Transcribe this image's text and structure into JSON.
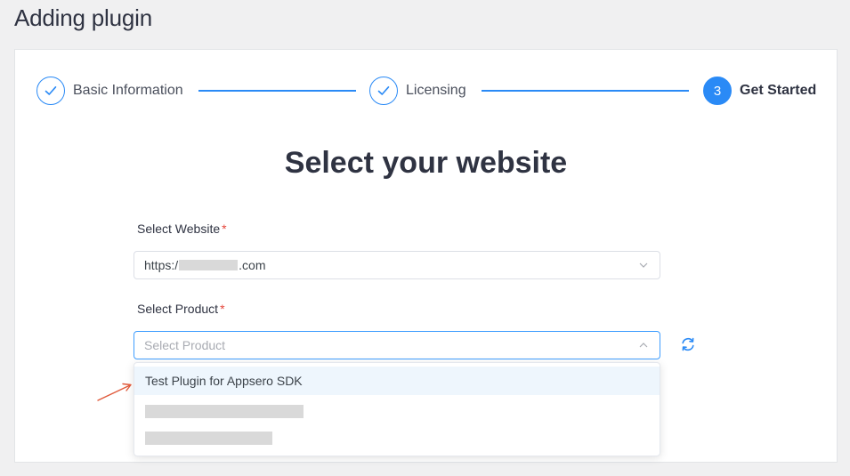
{
  "page": {
    "title": "Adding plugin"
  },
  "steps": [
    {
      "label": "Basic Information",
      "state": "done"
    },
    {
      "label": "Licensing",
      "state": "done"
    },
    {
      "number": "3",
      "label": "Get Started",
      "state": "active"
    }
  ],
  "main": {
    "heading": "Select your website",
    "website_field": {
      "label": "Select Website",
      "required_mark": "*",
      "value_prefix": "https:/",
      "value_suffix": ".com"
    },
    "product_field": {
      "label": "Select Product",
      "required_mark": "*",
      "placeholder": "Select Product"
    },
    "dropdown": {
      "options": [
        "Test Plugin for Appsero SDK"
      ]
    }
  },
  "colors": {
    "accent": "#2a8af6",
    "required": "#e5483d",
    "annotation_arrow": "#e0593a"
  },
  "icons": [
    "check-icon",
    "chevron-down-icon",
    "chevron-up-icon",
    "refresh-icon",
    "annotation-arrow-icon"
  ]
}
